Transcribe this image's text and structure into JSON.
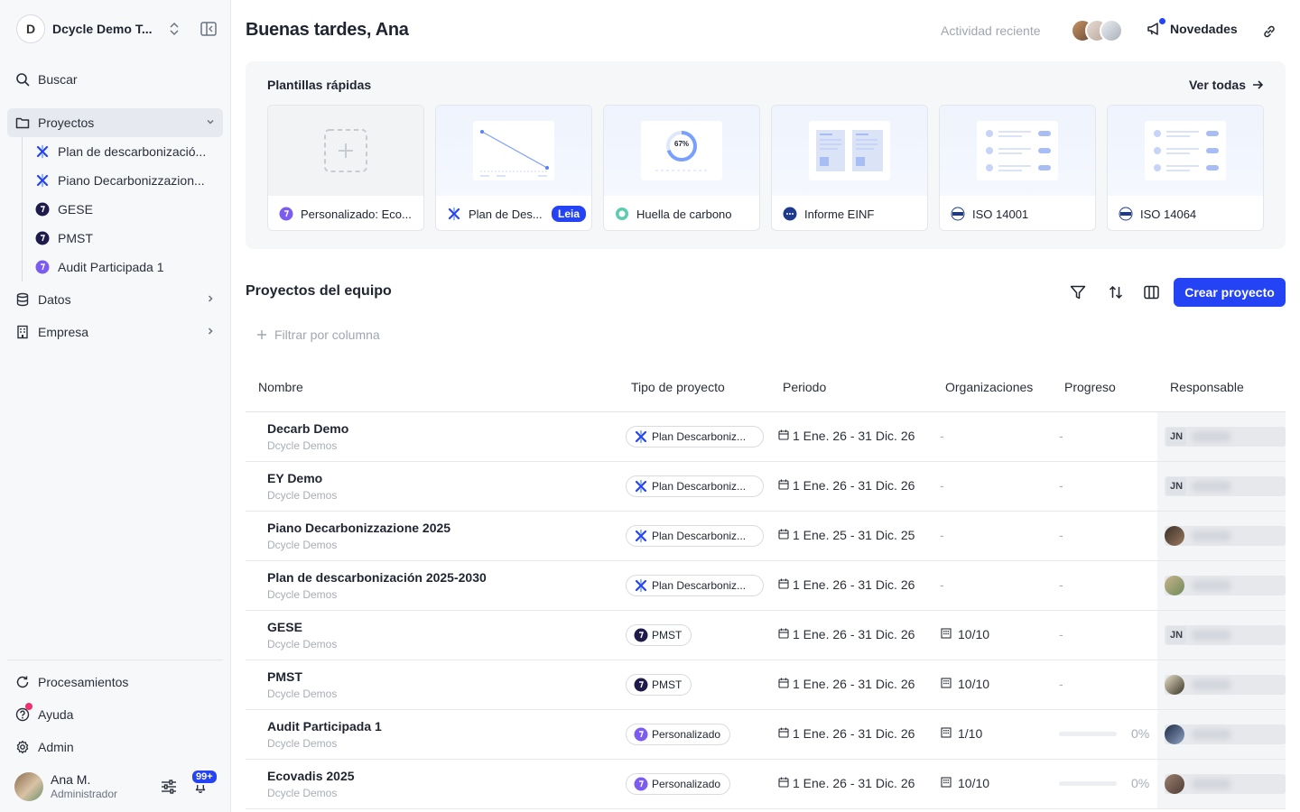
{
  "workspace": {
    "initial": "D",
    "name": "Dcycle Demo T..."
  },
  "sidebar": {
    "search_label": "Buscar",
    "projects_label": "Proyectos",
    "projects_sub": [
      {
        "label": "Plan de descarbonizació...",
        "icon": "decarb-icon"
      },
      {
        "label": "Piano Decarbonizzazion...",
        "icon": "decarb-icon"
      },
      {
        "label": "GESE",
        "icon": "pmst-icon"
      },
      {
        "label": "PMST",
        "icon": "pmst-icon"
      },
      {
        "label": "Audit Participada 1",
        "icon": "custom-icon"
      }
    ],
    "data_label": "Datos",
    "company_label": "Empresa",
    "processing_label": "Procesamientos",
    "help_label": "Ayuda",
    "admin_label": "Admin"
  },
  "user": {
    "name": "Ana M.",
    "role": "Administrador",
    "notifications": "99+"
  },
  "header": {
    "greeting": "Buenas tardes, Ana",
    "recent_activity": "Actividad reciente",
    "news_label": "Novedades"
  },
  "templates": {
    "title": "Plantillas rápidas",
    "see_all": "Ver todas",
    "cards": [
      {
        "label": "Personalizado: Eco...",
        "icon": "custom-icon"
      },
      {
        "label": "Plan de Des...",
        "badge": "Leia",
        "icon": "decarb-icon"
      },
      {
        "label": "Huella de carbono",
        "icon": "footprint-icon",
        "thumb_value": "67%"
      },
      {
        "label": "Informe EINF",
        "icon": "einf-icon"
      },
      {
        "label": "ISO 14001",
        "icon": "iso-icon"
      },
      {
        "label": "ISO 14064",
        "icon": "iso-icon"
      }
    ]
  },
  "projects": {
    "title": "Proyectos del equipo",
    "create_label": "Crear proyecto",
    "filter_placeholder": "Filtrar por columna",
    "columns": {
      "name": "Nombre",
      "type": "Tipo de proyecto",
      "period": "Periodo",
      "orgs": "Organizaciones",
      "progress": "Progreso",
      "owner": "Responsable"
    },
    "rows": [
      {
        "name": "Decarb Demo",
        "org": "Dcycle Demos",
        "type": "Plan Descarboniz...",
        "type_icon": "decarb-icon",
        "period": "1 Ene. 26 - 31 Dic. 26",
        "orgs": "-",
        "progress": "-",
        "owner_initials": "JN"
      },
      {
        "name": "EY Demo",
        "org": "Dcycle Demos",
        "type": "Plan Descarboniz...",
        "type_icon": "decarb-icon",
        "period": "1 Ene. 26 - 31 Dic. 26",
        "orgs": "-",
        "progress": "-",
        "owner_initials": "JN"
      },
      {
        "name": "Piano Decarbonizzazione 2025",
        "org": "Dcycle Demos",
        "type": "Plan Descarboniz...",
        "type_icon": "decarb-icon",
        "period": "1 Ene. 25 - 31 Dic. 25",
        "orgs": "-",
        "progress": "-",
        "owner_initials": ""
      },
      {
        "name": "Plan de descarbonización 2025-2030",
        "org": "Dcycle Demos",
        "type": "Plan Descarboniz...",
        "type_icon": "decarb-icon",
        "period": "1 Ene. 26 - 31 Dic. 26",
        "orgs": "-",
        "progress": "-",
        "owner_initials": ""
      },
      {
        "name": "GESE",
        "org": "Dcycle Demos",
        "type": "PMST",
        "type_icon": "pmst-icon",
        "period": "1 Ene. 26 - 31 Dic. 26",
        "orgs": "10/10",
        "progress": "-",
        "owner_initials": "JN"
      },
      {
        "name": "PMST",
        "org": "Dcycle Demos",
        "type": "PMST",
        "type_icon": "pmst-icon",
        "period": "1 Ene. 26 - 31 Dic. 26",
        "orgs": "10/10",
        "progress": "-",
        "owner_initials": ""
      },
      {
        "name": "Audit Participada 1",
        "org": "Dcycle Demos",
        "type": "Personalizado",
        "type_icon": "custom-icon",
        "period": "1 Ene. 26 - 31 Dic. 26",
        "orgs": "1/10",
        "progress": "0%",
        "owner_initials": ""
      },
      {
        "name": "Ecovadis 2025",
        "org": "Dcycle Demos",
        "type": "Personalizado",
        "type_icon": "custom-icon",
        "period": "1 Ene. 26 - 31 Dic. 26",
        "orgs": "10/10",
        "progress": "0%",
        "owner_initials": ""
      }
    ]
  },
  "colors": {
    "primary": "#2443f4",
    "sidebar_bg": "#f7f8fa",
    "notification_dot": "#f0306a"
  }
}
